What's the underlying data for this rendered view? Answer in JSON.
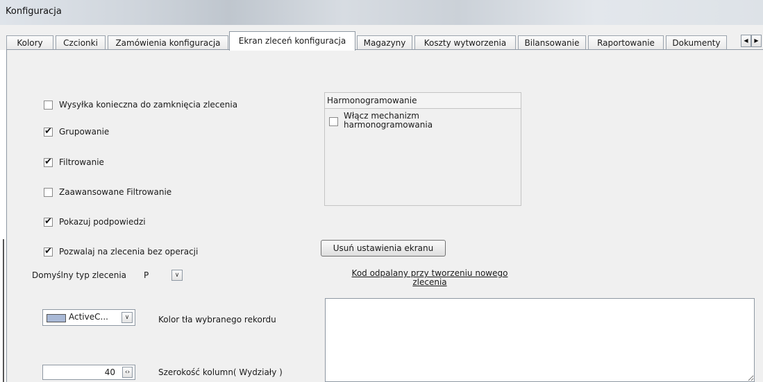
{
  "window": {
    "title": "Konfiguracja"
  },
  "tabs": [
    {
      "label": "Kolory"
    },
    {
      "label": "Czcionki"
    },
    {
      "label": "Zamówienia konfiguracja"
    },
    {
      "label": "Ekran zleceń konfiguracja",
      "active": true
    },
    {
      "label": "Magazyny"
    },
    {
      "label": "Koszty wytworzenia"
    },
    {
      "label": "Bilansowanie"
    },
    {
      "label": "Raportowanie"
    },
    {
      "label": "Dokumenty"
    }
  ],
  "checkboxes": [
    {
      "label": "Wysyłka konieczna do zamknięcia zlecenia",
      "checked": false
    },
    {
      "label": "Grupowanie",
      "checked": true
    },
    {
      "label": "Filtrowanie",
      "checked": true
    },
    {
      "label": "Zaawansowane Filtrowanie",
      "checked": false
    },
    {
      "label": "Pokazuj podpowiedzi",
      "checked": true
    },
    {
      "label": "Pozwalaj na zlecenia bez operacji",
      "checked": true
    }
  ],
  "default_type": {
    "label": "Domyślny typ zlecenia",
    "value": "P"
  },
  "color_picker": {
    "value": "ActiveC...",
    "label": "Kolor tła wybranego rekordu",
    "swatch_color": "#a9b9d6"
  },
  "column_width": {
    "value": "40",
    "label": "Szerokość kolumn( Wydziały )"
  },
  "scheduling": {
    "title": "Harmonogramowanie",
    "enable": {
      "label": "Włącz mechanizm harmonogramowania",
      "checked": false
    }
  },
  "reset_button": {
    "label": "Usuń ustawienia ekranu"
  },
  "code_section": {
    "label": "Kod odpalany przy tworzeniu nowego zlecenia",
    "value": ""
  }
}
